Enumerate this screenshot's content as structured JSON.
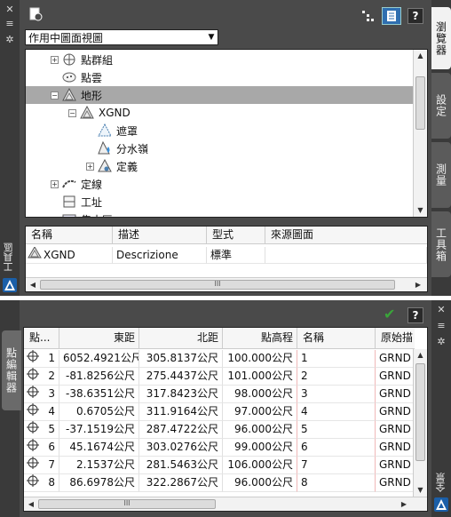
{
  "top_palette": {
    "left_strip": {
      "close": "✕",
      "menu": "≡",
      "settings": "✲",
      "title": "工具區"
    },
    "toolbar": {
      "help": "?"
    },
    "view_select": {
      "value": "作用中圖面視圖"
    },
    "tree": {
      "items": [
        {
          "label": "點群組",
          "icon": "point-group-icon",
          "expander": "+"
        },
        {
          "label": "點雲",
          "icon": "point-cloud-icon",
          "expander": ""
        },
        {
          "label": "地形",
          "icon": "surface-icon",
          "expander": "−",
          "selected": true
        },
        {
          "label": "XGND",
          "icon": "surface-icon",
          "expander": "−"
        },
        {
          "label": "遮罩",
          "icon": "mask-icon",
          "expander": ""
        },
        {
          "label": "分水嶺",
          "icon": "watershed-icon",
          "expander": ""
        },
        {
          "label": "定義",
          "icon": "definition-icon",
          "expander": "+"
        },
        {
          "label": "定線",
          "icon": "alignment-icon",
          "expander": "+"
        },
        {
          "label": "工址",
          "icon": "site-icon",
          "expander": ""
        },
        {
          "label": "集水區",
          "icon": "catchment-icon",
          "expander": ""
        }
      ]
    },
    "table": {
      "columns": [
        "名稱",
        "描述",
        "型式",
        "來源圖面"
      ],
      "rows": [
        {
          "name": "XGND",
          "desc": "Descrizione",
          "type": "標準",
          "source": ""
        }
      ]
    },
    "right_tabs": [
      "瀏覽器",
      "設定",
      "測量",
      "工具箱"
    ],
    "autodesk_icon": "autodesk-logo-icon"
  },
  "bottom_palette": {
    "left_tab": "點編輯器",
    "right_strip": {
      "close": "✕",
      "menu": "≡",
      "settings": "✲",
      "title": "全景"
    },
    "toolbar": {
      "help": "?"
    },
    "grid": {
      "columns": [
        "點...",
        "東距",
        "北距",
        "點高程",
        "名稱",
        "原始描"
      ],
      "rows": [
        {
          "num": "1",
          "east": "6052.4921公尺",
          "north": "305.8137公尺",
          "elev": "100.000公尺",
          "name": "1",
          "raw": "GRND"
        },
        {
          "num": "2",
          "east": "-81.8256公尺",
          "north": "275.4437公尺",
          "elev": "101.000公尺",
          "name": "2",
          "raw": "GRND"
        },
        {
          "num": "3",
          "east": "-38.6351公尺",
          "north": "317.8423公尺",
          "elev": "98.000公尺",
          "name": "3",
          "raw": "GRND"
        },
        {
          "num": "4",
          "east": "0.6705公尺",
          "north": "311.9164公尺",
          "elev": "97.000公尺",
          "name": "4",
          "raw": "GRND"
        },
        {
          "num": "5",
          "east": "-37.1519公尺",
          "north": "287.4722公尺",
          "elev": "96.000公尺",
          "name": "5",
          "raw": "GRND"
        },
        {
          "num": "6",
          "east": "45.1674公尺",
          "north": "303.0276公尺",
          "elev": "99.000公尺",
          "name": "6",
          "raw": "GRND"
        },
        {
          "num": "7",
          "east": "2.1537公尺",
          "north": "281.5463公尺",
          "elev": "106.000公尺",
          "name": "7",
          "raw": "GRND"
        },
        {
          "num": "8",
          "east": "86.6978公尺",
          "north": "322.2867公尺",
          "elev": "96.000公尺",
          "name": "8",
          "raw": "GRND"
        }
      ]
    }
  }
}
